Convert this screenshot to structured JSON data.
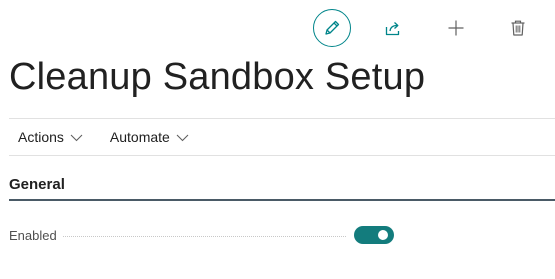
{
  "toolbar": {
    "icons": {
      "edit": "pencil-icon",
      "share": "share-icon",
      "add": "plus-icon",
      "delete": "trash-icon"
    },
    "accent_color": "#00858a"
  },
  "page": {
    "title": "Cleanup Sandbox Setup"
  },
  "menu": {
    "items": [
      {
        "label": "Actions",
        "icon": "chevron-down-icon"
      },
      {
        "label": "Automate",
        "icon": "chevron-down-icon"
      }
    ]
  },
  "section": {
    "title": "General"
  },
  "fields": [
    {
      "label": "Enabled",
      "value": true,
      "toggle_color": "#137c7d"
    }
  ]
}
